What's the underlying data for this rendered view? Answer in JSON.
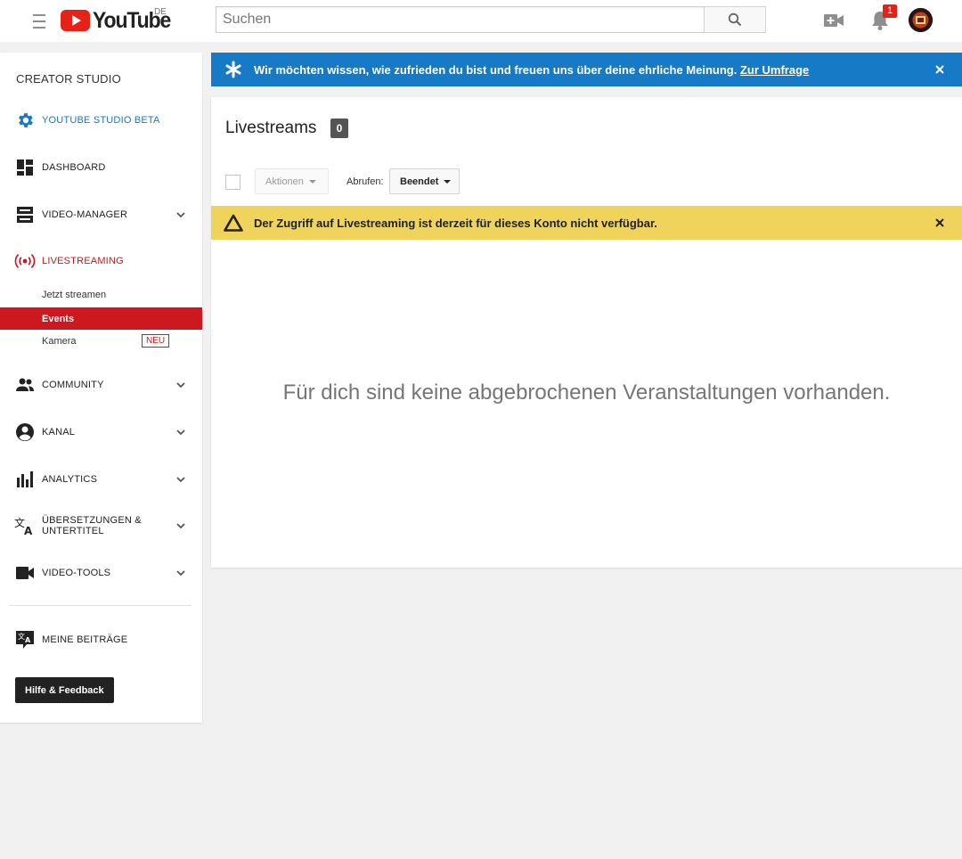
{
  "header": {
    "logo_text": "YouTube",
    "country": "DE",
    "search_placeholder": "Suchen",
    "notification_count": "1"
  },
  "sidebar": {
    "title": "CREATOR STUDIO",
    "items": [
      {
        "label": "YOUTUBE STUDIO BETA",
        "icon": "gear-icon",
        "color": "#167ac6"
      },
      {
        "label": "DASHBOARD",
        "icon": "dashboard-icon"
      },
      {
        "label": "VIDEO-MANAGER",
        "icon": "video-manager-icon",
        "expandable": true
      },
      {
        "label": "LIVESTREAMING",
        "icon": "live-broadcast-icon",
        "color": "#cc181e"
      },
      {
        "label": "COMMUNITY",
        "icon": "people-icon",
        "expandable": true
      },
      {
        "label": "KANAL",
        "icon": "account-circle-icon",
        "expandable": true
      },
      {
        "label": "ANALYTICS",
        "icon": "bar-chart-icon",
        "expandable": true
      },
      {
        "label": "ÜBERSETZUNGEN &",
        "label2": "UNTERTITEL",
        "icon": "translate-icon",
        "expandable": true
      },
      {
        "label": "VIDEO-TOOLS",
        "icon": "video-camera-icon",
        "expandable": true
      },
      {
        "label": "MEINE BEITRÄGE",
        "icon": "translate-bubble-icon"
      }
    ],
    "livestreaming_subitems": [
      {
        "label": "Jetzt streamen"
      },
      {
        "label": "Events",
        "active": true
      },
      {
        "label": "Kamera",
        "badge": "NEU"
      }
    ],
    "help_button": "Hilfe & Feedback"
  },
  "survey": {
    "text": "Wir möchten wissen, wie zufrieden du bist und freuen uns über deine ehrliche Meinung.",
    "link": "Zur Umfrage",
    "color": "#167ac6"
  },
  "main": {
    "title": "Livestreams",
    "count": "0",
    "actions_label": "Aktionen",
    "fetch_label": "Abrufen:",
    "fetch_value": "Beendet",
    "warning": "Der Zugriff auf Livestreaming ist derzeit für dieses Konto nicht verfügbar.",
    "warning_color": "#f0d35b",
    "empty_message": "Für dich sind keine abgebrochenen Veranstaltungen vorhanden."
  }
}
